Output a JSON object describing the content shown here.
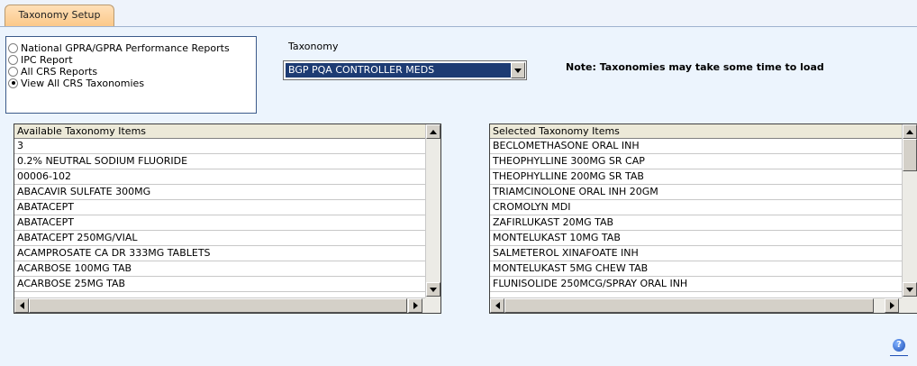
{
  "tabs": [
    {
      "label": "Taxonomy Setup"
    }
  ],
  "report_options": [
    {
      "label": "National GPRA/GPRA Performance Reports",
      "checked": false
    },
    {
      "label": "IPC Report",
      "checked": false
    },
    {
      "label": "All CRS Reports",
      "checked": false
    },
    {
      "label": "View All CRS Taxonomies",
      "checked": true
    }
  ],
  "taxonomy": {
    "label": "Taxonomy",
    "selected": "BGP PQA CONTROLLER MEDS"
  },
  "note": "Note:  Taxonomies may take some time to load",
  "available": {
    "header": "Available Taxonomy Items",
    "items": [
      "3",
      "0.2% NEUTRAL SODIUM FLUORIDE",
      "00006-102",
      "ABACAVIR SULFATE 300MG",
      "ABATACEPT",
      "ABATACEPT",
      "ABATACEPT 250MG/VIAL",
      "ACAMPROSATE CA DR 333MG TABLETS",
      "ACARBOSE 100MG TAB",
      "ACARBOSE 25MG TAB"
    ]
  },
  "selected": {
    "header": "Selected Taxonomy Items",
    "items": [
      "BECLOMETHASONE ORAL INH",
      "THEOPHYLLINE 300MG SR CAP",
      "THEOPHYLLINE 200MG SR TAB",
      "TRIAMCINOLONE ORAL INH 20GM",
      "CROMOLYN MDI",
      "ZAFIRLUKAST 20MG TAB",
      "MONTELUKAST 10MG TAB",
      "SALMETEROL XINAFOATE INH",
      "MONTELUKAST 5MG CHEW TAB",
      "FLUNISOLIDE 250MCG/SPRAY ORAL INH"
    ]
  },
  "help": {
    "glyph": "?"
  },
  "colors": {
    "accent": "#1d3b73",
    "tab": "#fbc98a",
    "background": "#ecf4fd"
  }
}
